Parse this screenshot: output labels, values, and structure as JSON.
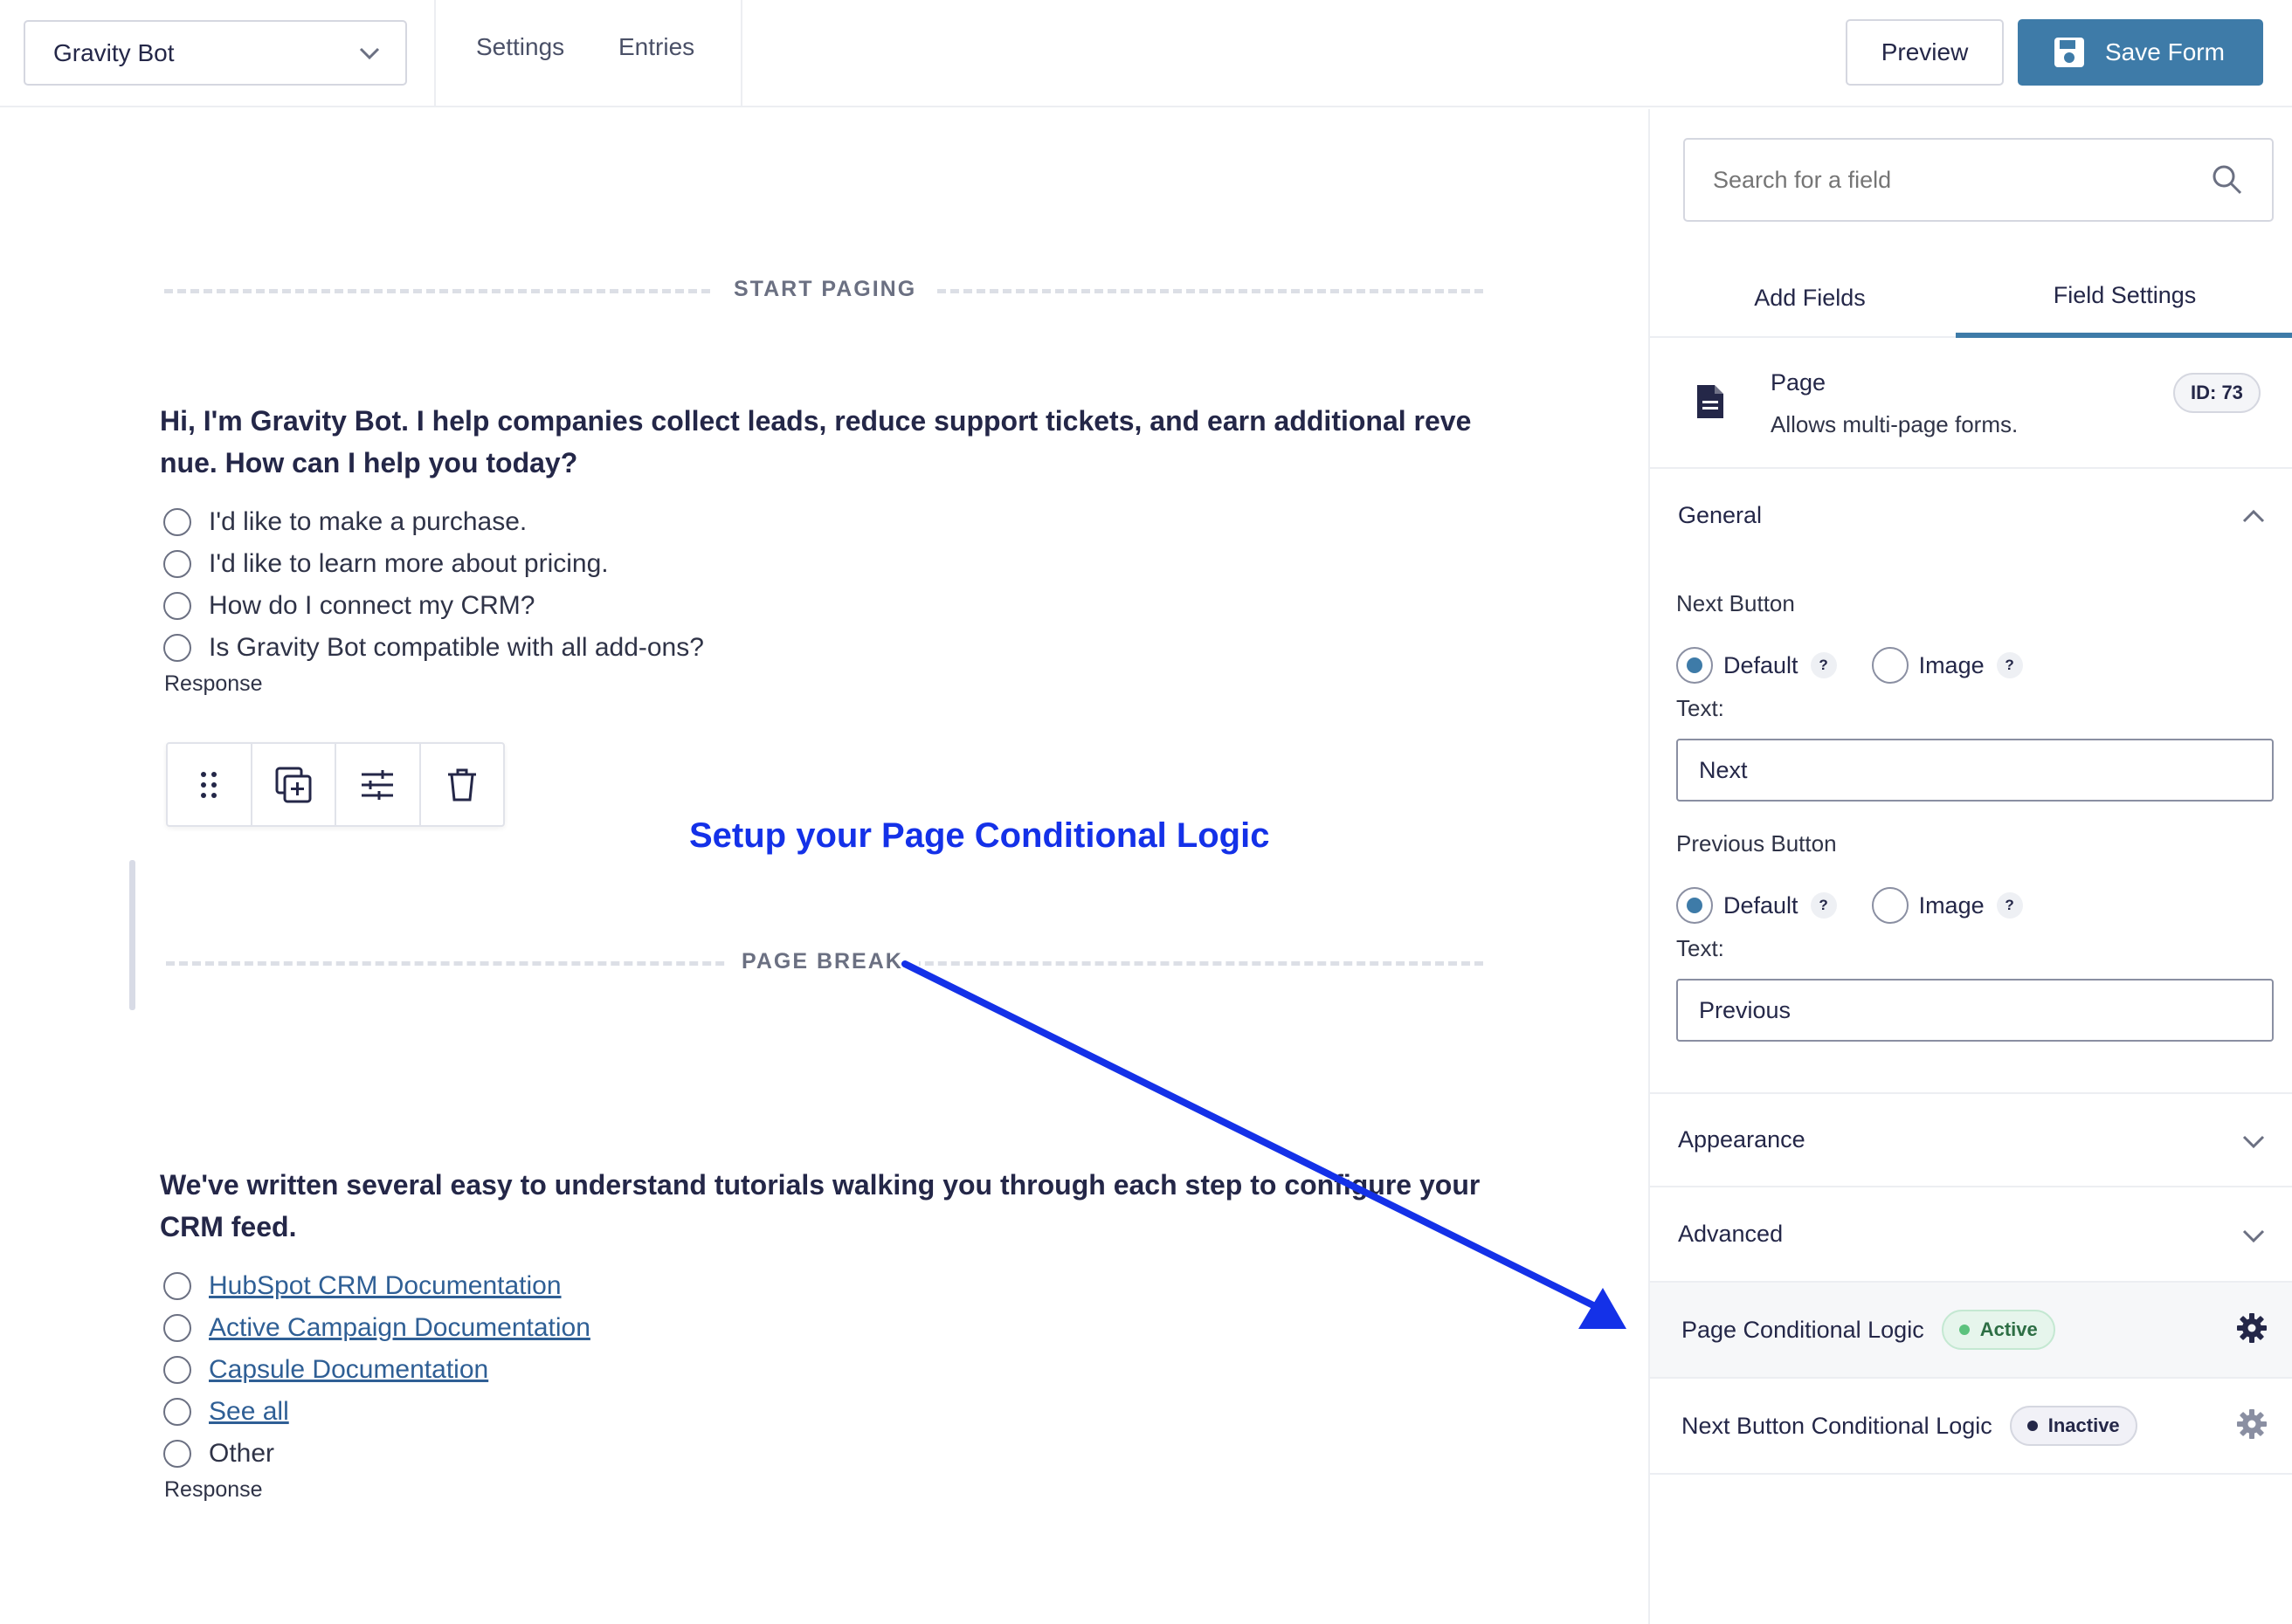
{
  "topbar": {
    "form_name": "Gravity Bot",
    "links": [
      "Settings",
      "Entries"
    ],
    "preview_label": "Preview",
    "save_label": "Save Form"
  },
  "canvas": {
    "start_paging_label": "START PAGING",
    "page_break_label": "PAGE BREAK",
    "question1": {
      "text": "Hi, I'm Gravity Bot. I help companies collect leads, reduce support tickets, and earn additional revenue. How can I help you today?",
      "choices": [
        "I'd like to make a purchase.",
        "I'd like to learn more about pricing.",
        "How do I connect my CRM?",
        "Is Gravity Bot compatible with all add-ons?"
      ],
      "label": "Response"
    },
    "question2": {
      "text": "We've written several easy to understand tutorials walking you through each step to configure your CRM feed.",
      "links": [
        "HubSpot CRM Documentation",
        "Active Campaign Documentation",
        "Capsule Documentation",
        "See all"
      ],
      "other": "Other",
      "label": "Response"
    },
    "annotation": "Setup your Page Conditional Logic",
    "annotation_color": "#1431e8"
  },
  "panel": {
    "search_placeholder": "Search for a field",
    "tabs": [
      "Add Fields",
      "Field Settings"
    ],
    "active_tab": "Field Settings",
    "field": {
      "title": "Page",
      "description": "Allows multi-page forms.",
      "id_badge": "ID: 73",
      "icon": "document-icon"
    },
    "general": {
      "title": "General",
      "next_button": {
        "label": "Next Button",
        "option_default": "Default",
        "option_image": "Image",
        "selected": "Default",
        "help": "?",
        "text_label": "Text:",
        "text_value": "Next"
      },
      "previous_button": {
        "label": "Previous Button",
        "option_default": "Default",
        "option_image": "Image",
        "selected": "Default",
        "help": "?",
        "text_label": "Text:",
        "text_value": "Previous"
      }
    },
    "appearance_title": "Appearance",
    "advanced_title": "Advanced",
    "page_logic": {
      "label": "Page Conditional Logic",
      "status": "Active"
    },
    "next_logic": {
      "label": "Next Button Conditional Logic",
      "status": "Inactive"
    }
  },
  "colors": {
    "accent": "#3e7ba8",
    "text": "#242748",
    "active_badge": "#5cc27d"
  }
}
